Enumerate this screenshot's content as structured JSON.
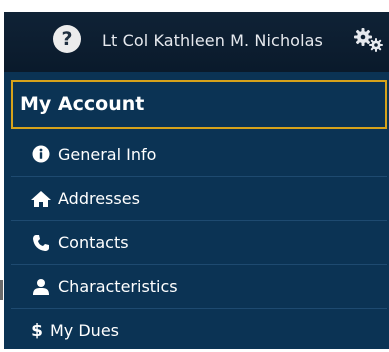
{
  "header": {
    "user_name": "Lt Col Kathleen M. Nicholas",
    "help_icon": "question-circle-icon",
    "settings_icon": "gears-icon"
  },
  "panel": {
    "title": "My Account",
    "accent_color": "#d6a21b",
    "background_color": "#0b3354"
  },
  "menu": {
    "items": [
      {
        "label": "General Info",
        "icon": "info-circle-icon"
      },
      {
        "label": "Addresses",
        "icon": "home-icon"
      },
      {
        "label": "Contacts",
        "icon": "phone-icon"
      },
      {
        "label": "Characteristics",
        "icon": "user-icon"
      },
      {
        "label": "My Dues",
        "icon": "dollar-icon"
      }
    ]
  }
}
